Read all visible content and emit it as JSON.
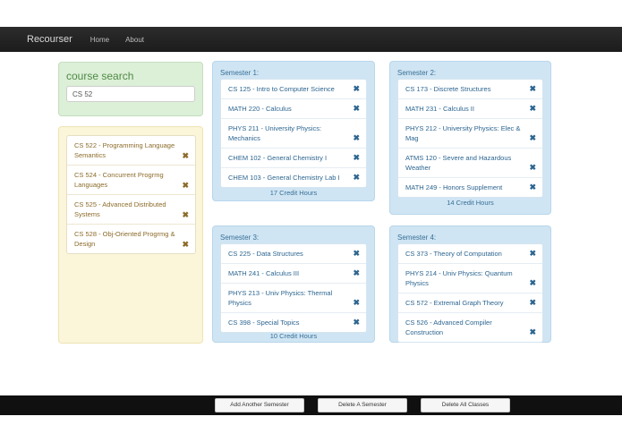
{
  "app": {
    "brand": "Recourser"
  },
  "nav": {
    "items": [
      "Home",
      "About"
    ]
  },
  "search": {
    "title": "course search",
    "value": "CS 52"
  },
  "results": [
    {
      "label": "CS 522 - Programming Language Semantics"
    },
    {
      "label": "CS 524 - Concurrent Progrmg Languages"
    },
    {
      "label": "CS 525 - Advanced Distributed Systems"
    },
    {
      "label": "CS 528 - Obj-Oriented Progrmg & Design"
    }
  ],
  "semesters": [
    {
      "title": "Semester 1:",
      "courses": [
        "CS 125 - Intro to Computer Science",
        "MATH 220 - Calculus",
        "PHYS 211 - University Physics: Mechanics",
        "CHEM 102 - General Chemistry I",
        "CHEM 103 - General Chemistry Lab I"
      ],
      "credits": "17 Credit Hours"
    },
    {
      "title": "Semester 2:",
      "courses": [
        "CS 173 - Discrete Structures",
        "MATH 231 - Calculus II",
        "PHYS 212 - University Physics: Elec & Mag",
        "ATMS 120 - Severe and Hazardous Weather",
        "MATH 249 - Honors Supplement"
      ],
      "credits": "14 Credit Hours"
    },
    {
      "title": "Semester 3:",
      "courses": [
        "CS 225 - Data Structures",
        "MATH 241 - Calculus III",
        "PHYS 213 - Univ Physics: Thermal Physics",
        "CS 398 - Special Topics"
      ],
      "credits": "10 Credit Hours"
    },
    {
      "title": "Semester 4:",
      "courses": [
        "CS 373 - Theory of Computation",
        "PHYS 214 - Univ Physics: Quantum Physics",
        "CS 572 - Extremal Graph Theory",
        "CS 526 - Advanced Compiler Construction"
      ],
      "credits": ""
    }
  ],
  "buttons": {
    "add_semester": "Add Another Semester",
    "delete_semester": "Delete A Semester",
    "delete_all": "Delete All Classes"
  },
  "icons": {
    "remove": "close-icon"
  },
  "colors": {
    "search_panel": "#dcefd7",
    "results_panel": "#fbf5d9",
    "semester_panel": "#cfe5f4",
    "navbar": "#222222"
  }
}
